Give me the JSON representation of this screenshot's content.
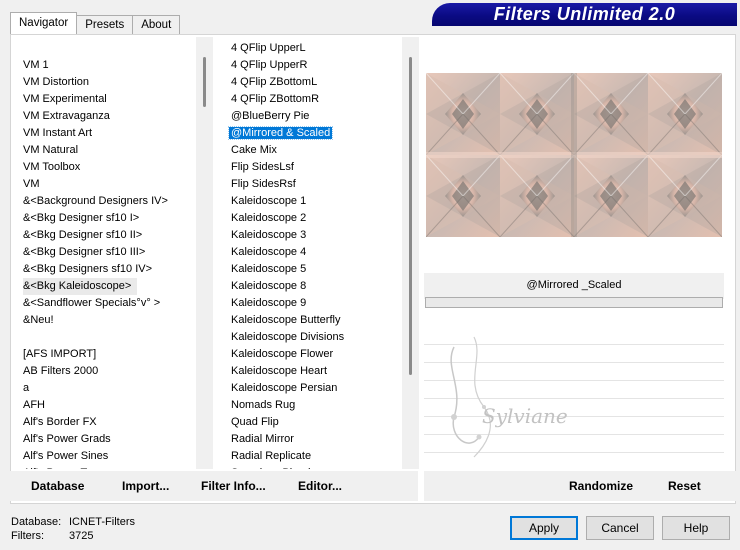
{
  "tabs": [
    {
      "label": "Navigator",
      "active": true
    },
    {
      "label": "Presets",
      "active": false
    },
    {
      "label": "About",
      "active": false
    }
  ],
  "banner": {
    "title": "Filters Unlimited 2.0"
  },
  "categories": {
    "items": [
      "VM 1",
      "VM Distortion",
      "VM Experimental",
      "VM Extravaganza",
      "VM Instant Art",
      "VM Natural",
      "VM Toolbox",
      "VM",
      "&<Background Designers IV>",
      "&<Bkg Designer sf10 I>",
      "&<Bkg Designer sf10 II>",
      "&<Bkg Designer sf10 III>",
      "&<Bkg Designers sf10 IV>",
      "&<Bkg Kaleidoscope>",
      "&<Sandflower Specials°v° >",
      "&Neu!",
      "",
      "[AFS IMPORT]",
      "AB Filters 2000",
      "a",
      "AFH",
      "Alf's Border FX",
      "Alf's Power Grads",
      "Alf's Power Sines",
      "Alf's Power Toys"
    ],
    "selected": "&<Bkg Kaleidoscope>"
  },
  "filters": {
    "items": [
      "4 QFlip UpperL",
      "4 QFlip UpperR",
      "4 QFlip ZBottomL",
      "4 QFlip ZBottomR",
      "@BlueBerry Pie",
      "@Mirrored & Scaled",
      "Cake Mix",
      "Flip SidesLsf",
      "Flip SidesRsf",
      "Kaleidoscope 1",
      "Kaleidoscope 2",
      "Kaleidoscope 3",
      "Kaleidoscope 4",
      "Kaleidoscope 5",
      "Kaleidoscope 8",
      "Kaleidoscope 9",
      "Kaleidoscope Butterfly",
      "Kaleidoscope Divisions",
      "Kaleidoscope Flower",
      "Kaleidoscope Heart",
      "Kaleidoscope Persian",
      "Nomads Rug",
      "Quad Flip",
      "Radial Mirror",
      "Radial Replicate",
      "Seamless Blend"
    ],
    "selected": "@Mirrored & Scaled"
  },
  "preview": {
    "filter_name": "@Mirrored _Scaled",
    "watermark_text": "Sylviane"
  },
  "actions_left": {
    "database": "Database",
    "import": "Import...",
    "filter_info": "Filter Info...",
    "editor": "Editor..."
  },
  "actions_right": {
    "randomize": "Randomize",
    "reset": "Reset"
  },
  "status": {
    "database_label": "Database:",
    "database_value": "ICNET-Filters",
    "filters_label": "Filters:",
    "filters_value": "3725"
  },
  "dialog": {
    "apply": "Apply",
    "cancel": "Cancel",
    "help": "Help"
  },
  "colors": {
    "banner": "#0b0b84",
    "selection": "#0078d7",
    "preview_dark": "#8d8a85",
    "preview_pink": "#e6c2b3"
  }
}
